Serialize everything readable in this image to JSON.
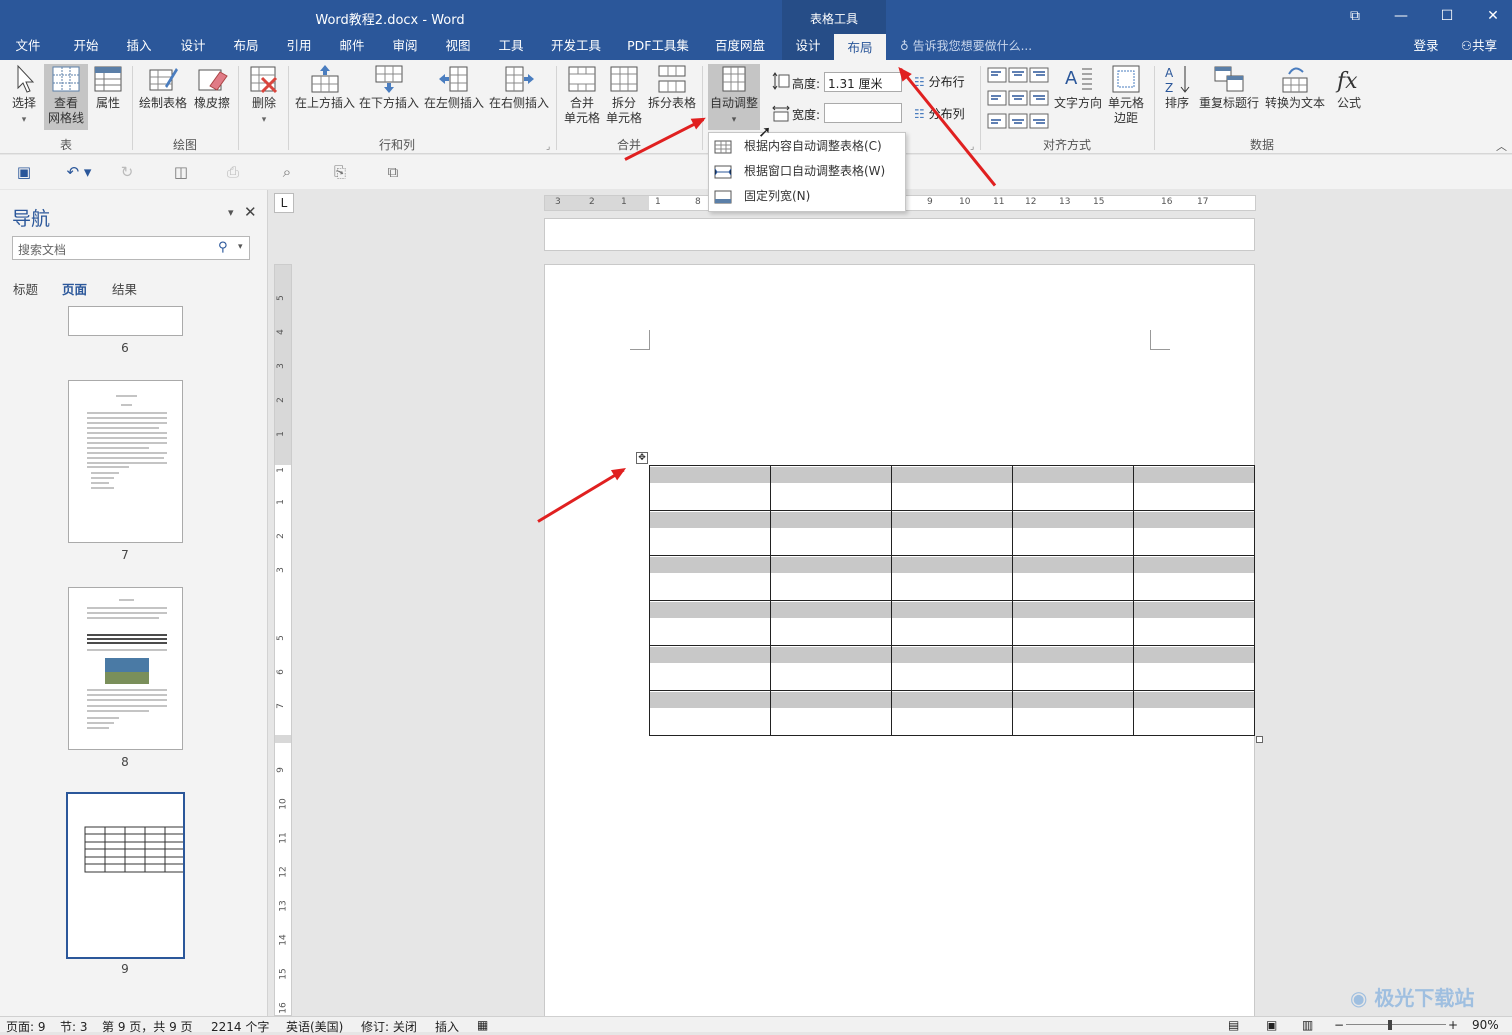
{
  "window": {
    "title": "Word教程2.docx - Word",
    "context_tab_group": "表格工具",
    "controls": [
      "⧉",
      "—",
      "☐",
      "✕"
    ]
  },
  "tabs": [
    "文件",
    "开始",
    "插入",
    "设计",
    "布局",
    "引用",
    "邮件",
    "审阅",
    "视图",
    "工具",
    "开发工具",
    "PDF工具集",
    "百度网盘"
  ],
  "context_tabs": [
    "设计",
    "布局"
  ],
  "tell_me": "告诉我您想要做什么...",
  "login": "登录",
  "share": "共享",
  "ribbon": {
    "select": "选择",
    "view_gridlines": "查看\n网格线",
    "properties": "属性",
    "draw_table": "绘制表格",
    "eraser": "橡皮擦",
    "delete": "删除",
    "insert_above": "在上方插入",
    "insert_below": "在下方插入",
    "insert_left": "在左侧插入",
    "insert_right": "在右侧插入",
    "merge_cells": "合并\n单元格",
    "split_cells": "拆分\n单元格",
    "split_table": "拆分表格",
    "autofit": "自动调整",
    "height_label": "高度:",
    "height_value": "1.31 厘米",
    "width_label": "宽度:",
    "width_value": "",
    "distribute_rows": "分布行",
    "distribute_cols": "分布列",
    "text_direction": "文字方向",
    "cell_margins": "单元格\n边距",
    "sort": "排序",
    "repeat_header": "重复标题行",
    "convert_to_text": "转换为文本",
    "formula": "公式",
    "groups": {
      "table": "表",
      "draw": "绘图",
      "rows_cols": "行和列",
      "merge": "合并",
      "alignment": "对齐方式",
      "data": "数据"
    }
  },
  "autofit_menu": [
    "根据内容自动调整表格(C)",
    "根据窗口自动调整表格(W)",
    "固定列宽(N)"
  ],
  "nav": {
    "title": "导航",
    "search_placeholder": "搜索文档",
    "tabs": [
      "标题",
      "页面",
      "结果"
    ],
    "active_tab": "页面",
    "pages": [
      "6",
      "7",
      "8",
      "9"
    ],
    "current_page": "9"
  },
  "ruler": {
    "h_labels": [
      "3",
      "2",
      "1",
      "1",
      "8",
      "9",
      "10",
      "11",
      "12",
      "13",
      "15",
      "16",
      "17"
    ],
    "v_labels": [
      "5",
      "4",
      "3",
      "2",
      "1",
      "1",
      "1",
      "2",
      "3",
      "5",
      "6",
      "7",
      "9",
      "10",
      "11",
      "12",
      "13",
      "14",
      "15",
      "16"
    ],
    "corner": "L"
  },
  "table": {
    "rows": 6,
    "cols": 5
  },
  "status": {
    "page": "页面: 9",
    "section": "节: 3",
    "page_of": "第 9 页，共 9 页",
    "words": "2214 个字",
    "language": "英语(美国)",
    "track": "修订: 关闭",
    "mode": "插入",
    "zoom": "90%"
  },
  "watermark": "极光下载站"
}
